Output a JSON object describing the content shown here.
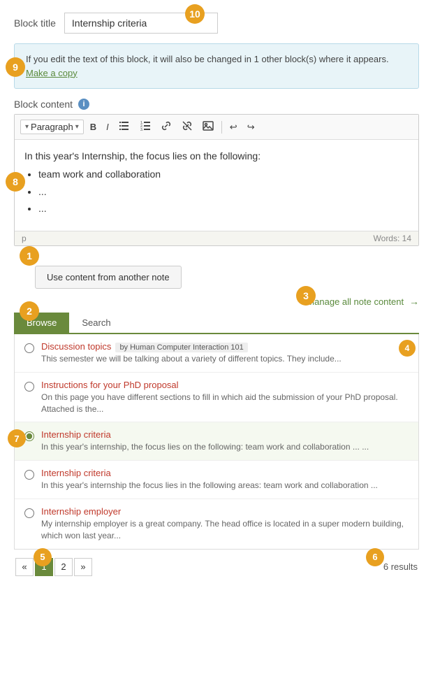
{
  "header": {
    "block_title_label": "Block title",
    "block_title_value": "Internship criteria"
  },
  "info_banner": {
    "message": "If you edit the text of this block, it will also be changed in 1 other block(s) where it appears.",
    "link_text": "Make a copy"
  },
  "block_content": {
    "label": "Block content",
    "toolbar": {
      "paragraph_label": "Paragraph",
      "bold": "B",
      "italic": "I",
      "bullet_list": "•≡",
      "numbered_list": "1≡",
      "link": "🔗",
      "unlink": "⛓",
      "image": "🖼",
      "undo": "↩",
      "redo": "↪"
    },
    "content_line": "In this year's Internship, the focus lies on the following:",
    "bullet1": "team work and collaboration",
    "bullet2": "...",
    "bullet3": "...",
    "statusbar_left": "p",
    "statusbar_right": "Words: 14"
  },
  "use_content_btn": "Use content from another note",
  "manage_link": "Manage all note content",
  "tabs": {
    "browse": "Browse",
    "search": "Search"
  },
  "notes": [
    {
      "id": "note1",
      "title": "Discussion topics",
      "tag": "by Human Computer Interaction 101",
      "desc": "This semester we will be talking about a variety of different topics. They include...",
      "selected": false
    },
    {
      "id": "note2",
      "title": "Instructions for your PhD proposal",
      "tag": "",
      "desc": "On this page you have different sections to fill in which aid the submission of your PhD proposal. Attached is the...",
      "selected": false
    },
    {
      "id": "note3",
      "title": "Internship criteria",
      "tag": "",
      "desc": "In this year's internship, the focus lies on the following: team work and collaboration ... ...",
      "selected": true
    },
    {
      "id": "note4",
      "title": "Internship criteria",
      "tag": "",
      "desc": "In this year's internship the focus lies in the following areas: team work and collaboration ...",
      "selected": false
    },
    {
      "id": "note5",
      "title": "Internship employer",
      "tag": "",
      "desc": "My internship employer is a great company. The head office is located in a super modern building, which won last year...",
      "selected": false
    }
  ],
  "pagination": {
    "prev": "«",
    "page1": "1",
    "page2": "2",
    "next": "»",
    "results": "6 results"
  },
  "badges": {
    "b1": "1",
    "b2": "2",
    "b3": "3",
    "b4": "4",
    "b5": "5",
    "b6": "6",
    "b7": "7",
    "b8": "8",
    "b9": "9",
    "b10": "10"
  }
}
